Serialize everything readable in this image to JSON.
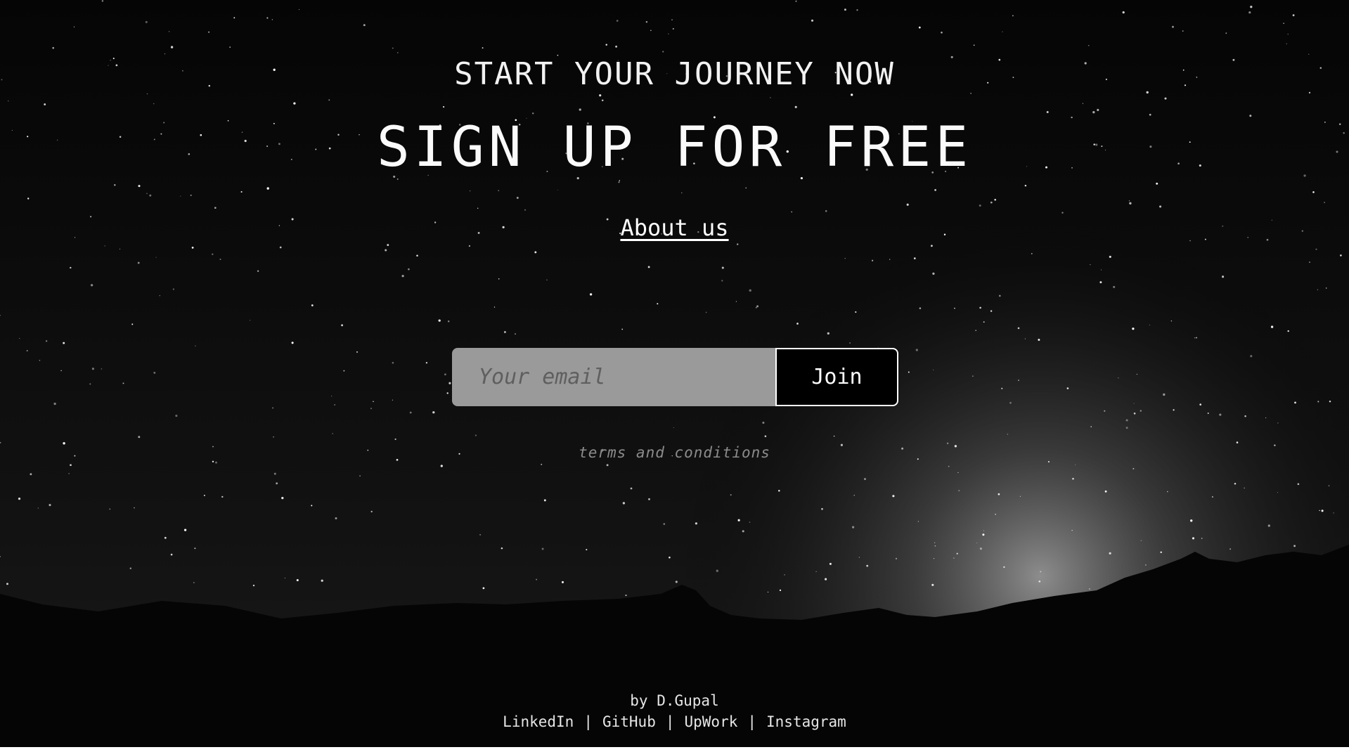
{
  "hero": {
    "eyebrow": "START YOUR JOURNEY NOW",
    "headline": "SIGN UP FOR FREE",
    "about_link": "About us"
  },
  "signup": {
    "email_placeholder": "Your email",
    "join_label": "Join"
  },
  "terms_link": "terms and conditions",
  "footer": {
    "byline": "by D.Gupal",
    "links": [
      "LinkedIn",
      "GitHub",
      "UpWork",
      "Instagram"
    ],
    "separator": "|"
  },
  "colors": {
    "background": "#000000",
    "text": "#ffffff",
    "input_bg": "#9a9a9a",
    "muted": "#8c8c8c"
  }
}
